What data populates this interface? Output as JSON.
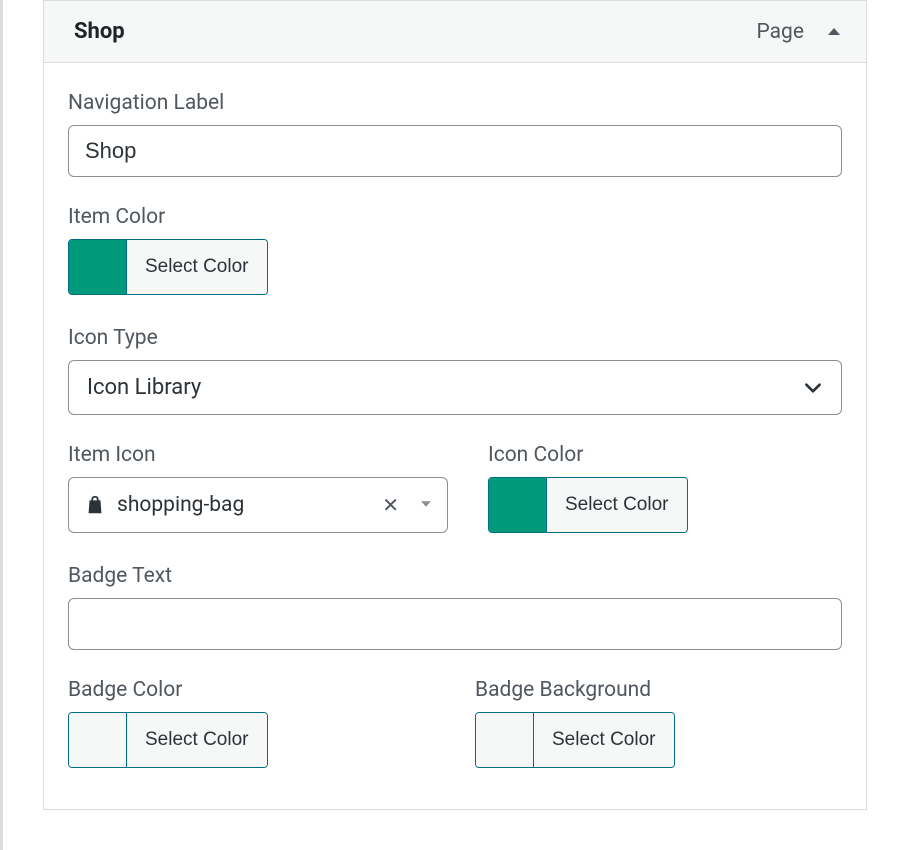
{
  "panel": {
    "title": "Shop",
    "type_label": "Page"
  },
  "fields": {
    "navigation_label": {
      "label": "Navigation Label",
      "value": "Shop"
    },
    "item_color": {
      "label": "Item Color",
      "button": "Select Color",
      "swatch": "#009a7b"
    },
    "icon_type": {
      "label": "Icon Type",
      "value": "Icon Library"
    },
    "item_icon": {
      "label": "Item Icon",
      "value": "shopping-bag"
    },
    "icon_color": {
      "label": "Icon Color",
      "button": "Select Color",
      "swatch": "#009a7b"
    },
    "badge_text": {
      "label": "Badge Text",
      "value": ""
    },
    "badge_color": {
      "label": "Badge Color",
      "button": "Select Color",
      "swatch": ""
    },
    "badge_background": {
      "label": "Badge Background",
      "button": "Select Color",
      "swatch": ""
    }
  }
}
